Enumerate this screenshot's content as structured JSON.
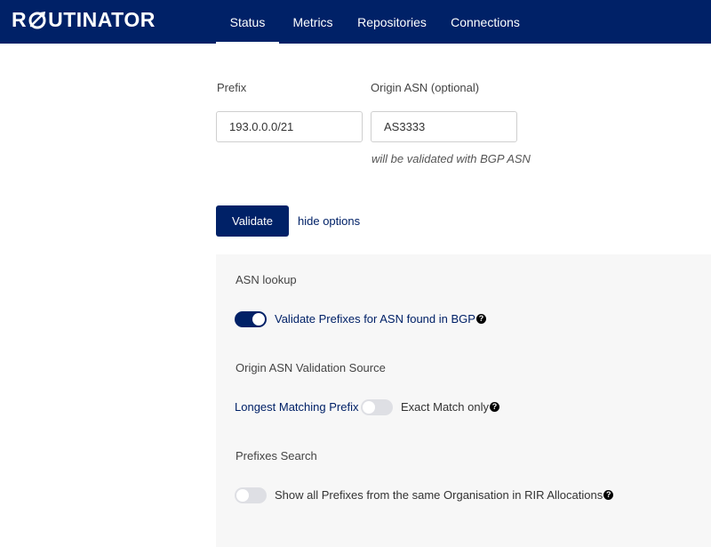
{
  "header": {
    "logo_text_pre": "R",
    "logo_text_post": "UTINATOR",
    "tabs": [
      {
        "label": "Status",
        "active": true
      },
      {
        "label": "Metrics",
        "active": false
      },
      {
        "label": "Repositories",
        "active": false
      },
      {
        "label": "Connections",
        "active": false
      }
    ]
  },
  "form": {
    "prefix_label": "Prefix",
    "prefix_value": "193.0.0.0/21",
    "asn_label": "Origin ASN (optional)",
    "asn_value": "AS3333",
    "asn_hint": "will be validated with BGP ASN",
    "validate_label": "Validate",
    "hide_options_label": "hide options"
  },
  "options": {
    "asn_lookup_title": "ASN lookup",
    "asn_lookup_toggle": {
      "label": "Validate Prefixes for ASN found in BGP",
      "on": true
    },
    "validation_source_title": "Origin ASN Validation Source",
    "validation_source_left": "Longest Matching Prefix",
    "validation_source_right": "Exact Match only",
    "validation_source_toggle_on": false,
    "prefixes_search_title": "Prefixes Search",
    "prefixes_search_toggle": {
      "label": "Show all Prefixes from the same Organisation in RIR Allocations",
      "on": false
    }
  },
  "colors": {
    "brand": "#002167",
    "panel_bg": "#f7f7f7",
    "toggle_off": "#dedfe4"
  },
  "icons": {
    "logo_o": "rocket-globe-icon",
    "help": "question-circle-icon"
  }
}
